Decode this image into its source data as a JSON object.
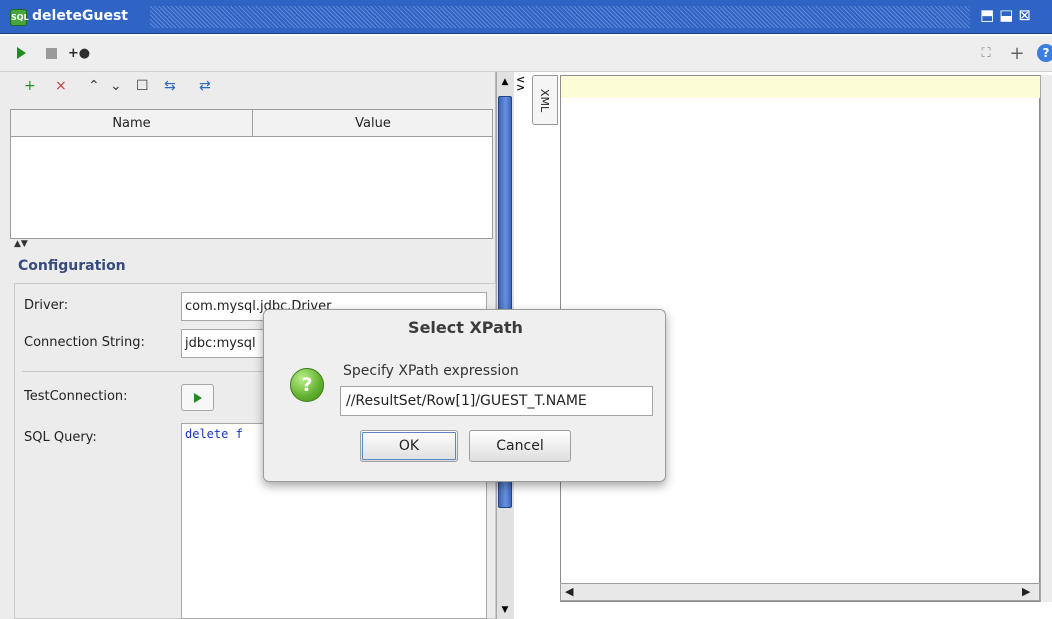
{
  "window": {
    "title": "deleteGuest",
    "icon_text": "SQL",
    "controls": "⬒⬓⊠"
  },
  "toolbar": {
    "play": "play-icon",
    "stop": "stop-icon",
    "add": "add-breakpoint-icon",
    "right1": "⛶",
    "right2": "+",
    "right3": "?"
  },
  "properties": {
    "icons": [
      "+",
      "×",
      "⌃",
      "⌄",
      "☐",
      "⇆",
      "⇄"
    ],
    "columns": [
      "Name",
      "Value"
    ]
  },
  "configuration": {
    "title": "Configuration",
    "driver_label": "Driver:",
    "driver_value": "com.mysql.jdbc.Driver",
    "connection_label": "Connection String:",
    "connection_value": "jdbc:mysql",
    "test_label": "TestConnection:",
    "sql_label": "SQL Query:",
    "sql_value": "delete f"
  },
  "xml_tab": "XML",
  "dialog": {
    "title": "Select XPath",
    "prompt": "Specify XPath expression",
    "xpath_value": "//ResultSet/Row[1]/GUEST_T.NAME",
    "ok": "OK",
    "cancel": "Cancel"
  },
  "colors": {
    "accent": "#2f63c4",
    "config_title": "#374b7c",
    "sql_text": "#1432c8",
    "editor_line": "#fcfcd6"
  }
}
